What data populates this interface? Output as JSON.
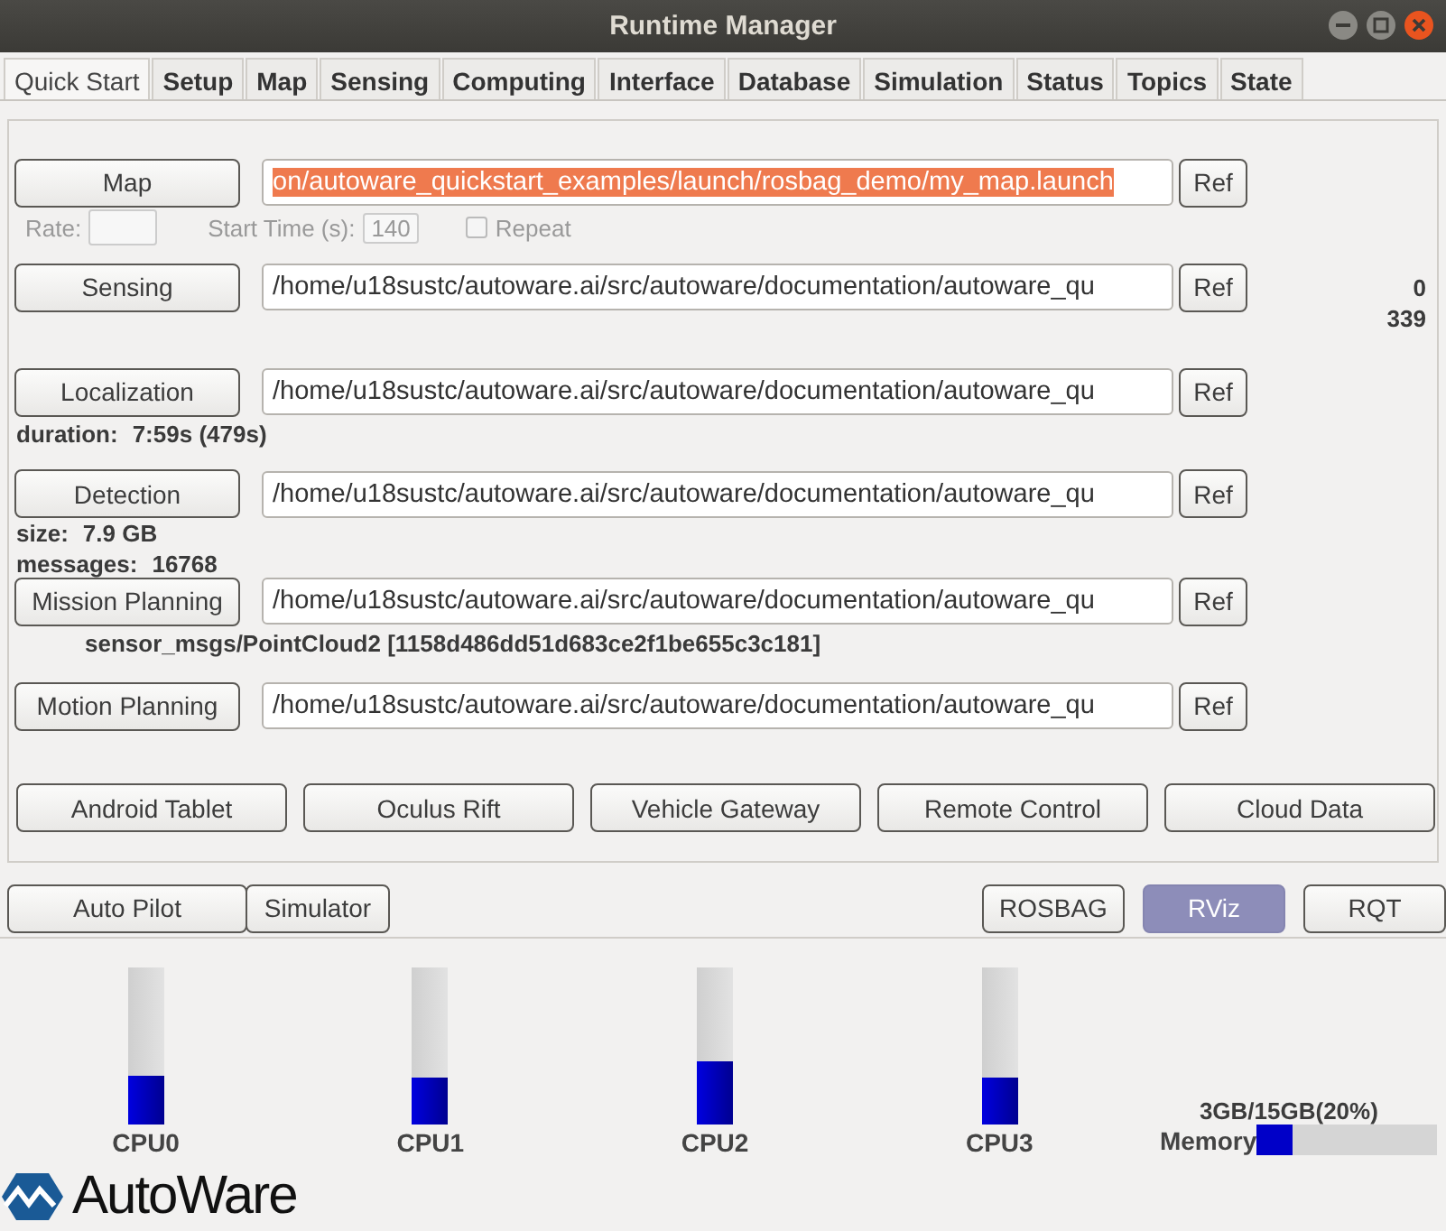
{
  "window": {
    "title": "Runtime Manager"
  },
  "tabs": [
    {
      "label": "Quick Start",
      "selected": true
    },
    {
      "label": "Setup",
      "selected": false
    },
    {
      "label": "Map",
      "selected": false
    },
    {
      "label": "Sensing",
      "selected": false
    },
    {
      "label": "Computing",
      "selected": false
    },
    {
      "label": "Interface",
      "selected": false
    },
    {
      "label": "Database",
      "selected": false
    },
    {
      "label": "Simulation",
      "selected": false
    },
    {
      "label": "Status",
      "selected": false
    },
    {
      "label": "Topics",
      "selected": false
    },
    {
      "label": "State",
      "selected": false
    }
  ],
  "launch_rows": [
    {
      "button": "Map",
      "path": "on/autoware_quickstart_examples/launch/rosbag_demo/my_map.launch",
      "selected": true,
      "ref": "Ref",
      "details": [
        {
          "kind": "playback",
          "rate_label": "Rate:",
          "start_label": "Start Time (s):",
          "start_value": "140",
          "repeat_label": "Repeat",
          "repeat": false
        }
      ]
    },
    {
      "button": "Sensing",
      "path": "/home/u18sustc/autoware.ai/src/autoware/documentation/autoware_qu",
      "selected": false,
      "ref": "Ref",
      "details": [
        {
          "kind": "counter",
          "values": [
            "0",
            "339"
          ]
        }
      ]
    },
    {
      "button": "Localization",
      "path": "/home/u18sustc/autoware.ai/src/autoware/documentation/autoware_qu",
      "selected": false,
      "ref": "Ref",
      "details": [
        {
          "kind": "kv",
          "label": "duration:",
          "value": "7:59s (479s)"
        }
      ]
    },
    {
      "button": "Detection",
      "path": "/home/u18sustc/autoware.ai/src/autoware/documentation/autoware_qu",
      "selected": false,
      "ref": "Ref",
      "details": [
        {
          "kind": "kv",
          "label": "size:",
          "value": "7.9 GB"
        },
        {
          "kind": "kv",
          "label": "messages:",
          "value": "16768"
        }
      ]
    },
    {
      "button": "Mission Planning",
      "path": "/home/u18sustc/autoware.ai/src/autoware/documentation/autoware_qu",
      "selected": false,
      "ref": "Ref",
      "details": [
        {
          "kind": "indented",
          "text": "sensor_msgs/PointCloud2 [1158d486dd51d683ce2f1be655c3c181]"
        }
      ]
    },
    {
      "button": "Motion Planning",
      "path": "/home/u18sustc/autoware.ai/src/autoware/documentation/autoware_qu",
      "selected": false,
      "ref": "Ref",
      "details": []
    }
  ],
  "device_buttons": [
    "Android Tablet",
    "Oculus Rift",
    "Vehicle Gateway",
    "Remote Control",
    "Cloud Data"
  ],
  "mode_buttons": [
    "Auto Pilot",
    "Simulator"
  ],
  "tool_buttons": [
    {
      "label": "ROSBAG",
      "selected": false
    },
    {
      "label": "RViz",
      "selected": true
    },
    {
      "label": "RQT",
      "selected": false
    }
  ],
  "cpus": [
    {
      "name": "CPU0",
      "level": 0.31
    },
    {
      "name": "CPU1",
      "level": 0.3
    },
    {
      "name": "CPU2",
      "level": 0.4
    },
    {
      "name": "CPU3",
      "level": 0.3
    }
  ],
  "memory": {
    "reading": "3GB/15GB(20%)",
    "label": "Memory",
    "level": 0.2
  },
  "logo": {
    "text": "AutoWare"
  }
}
